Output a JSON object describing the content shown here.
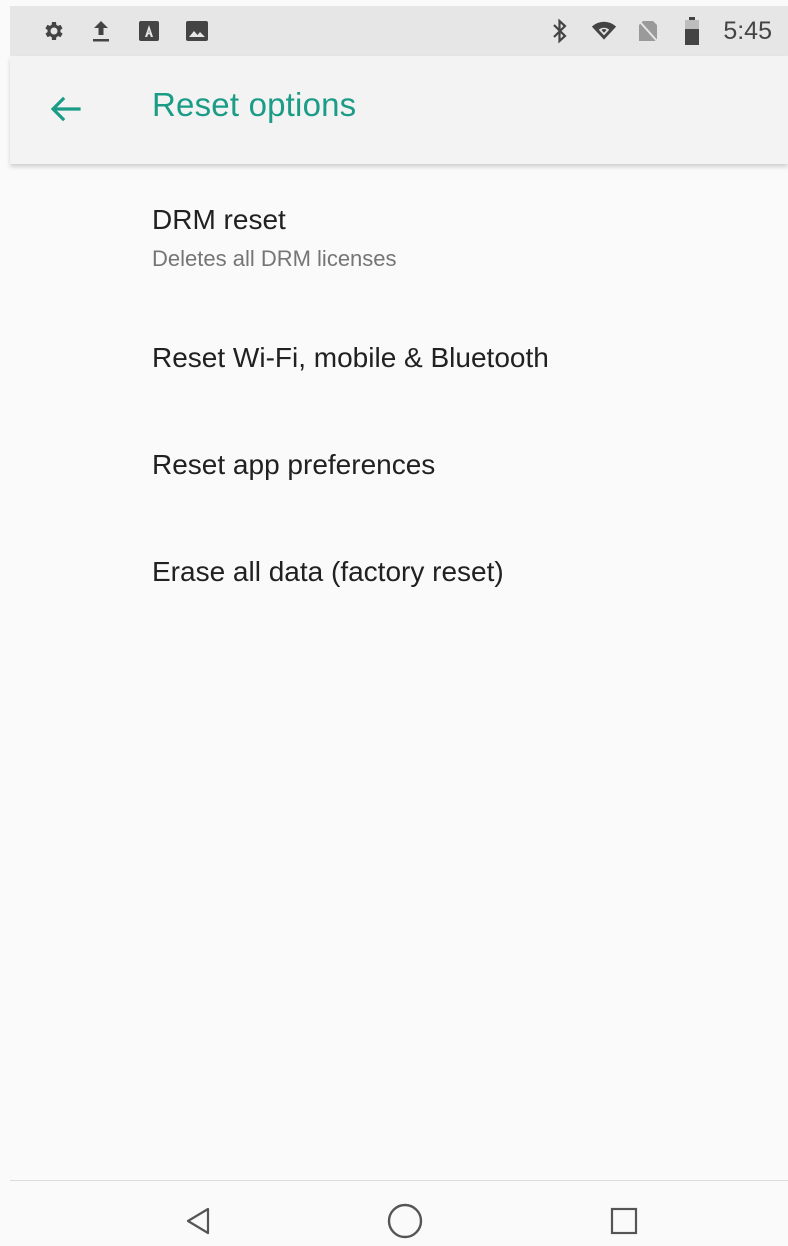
{
  "status_bar": {
    "time": "5:45",
    "left_icons": [
      "gear-icon",
      "upload-icon",
      "keyboard-a-icon",
      "image-icon"
    ],
    "right_icons": [
      "bluetooth-icon",
      "wifi-icon",
      "no-sim-icon",
      "battery-icon"
    ]
  },
  "app_bar": {
    "title": "Reset options",
    "back_icon": "arrow-left-icon",
    "accent_color": "#1a9c86"
  },
  "list": {
    "items": [
      {
        "title": "DRM reset",
        "subtitle": "Deletes all DRM licenses"
      },
      {
        "title": "Reset Wi-Fi, mobile & Bluetooth"
      },
      {
        "title": "Reset app preferences"
      },
      {
        "title": "Erase all data (factory reset)"
      }
    ]
  },
  "nav_bar": {
    "icons": [
      "back-triangle-icon",
      "home-circle-icon",
      "recents-square-icon"
    ]
  }
}
